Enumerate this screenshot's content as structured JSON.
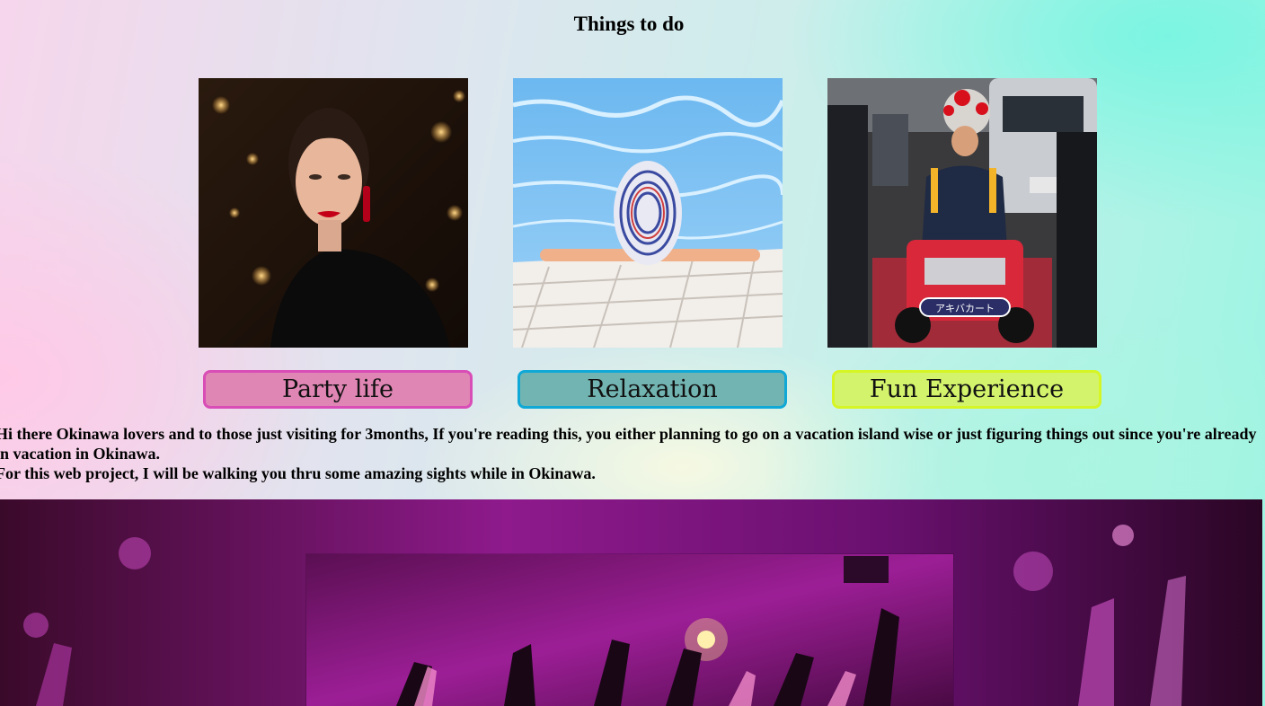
{
  "section": {
    "title": "Things to do"
  },
  "cards": [
    {
      "image": "woman-party-portrait-photo",
      "label": "Party life",
      "accent": "#d94db7"
    },
    {
      "image": "pool-sun-hat-photo",
      "label": "Relaxation",
      "accent": "#10a8d6"
    },
    {
      "image": "street-go-kart-photo",
      "label": "Fun Experience",
      "accent": "#d6f524"
    }
  ],
  "kart_sign": "アキバカート",
  "intro": {
    "line1": "Hi there Okinawa lovers and to those just visiting for 3months, If you're reading this, you either planning to go on a vacation island wise or just figuring things out since you're already in vacation in Okinawa.",
    "line2": "For this web project, I will be walking you thru some amazing sights while in Okinawa."
  },
  "banner": {
    "image": "concert-crowd-photo",
    "inner_image": "concert-crowd-photo"
  }
}
